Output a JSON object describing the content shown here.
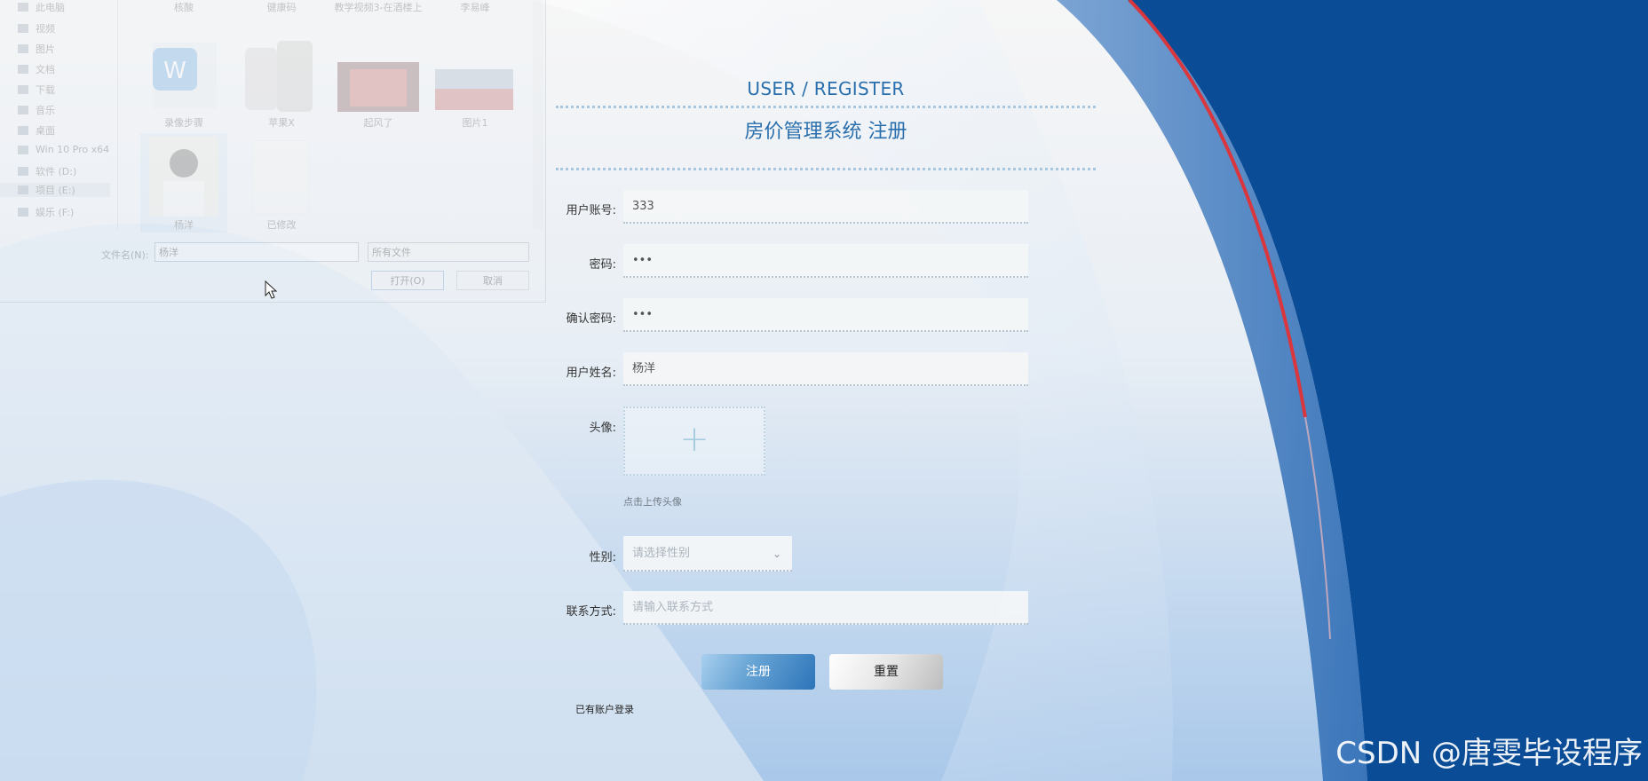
{
  "register": {
    "subtitle": "USER / REGISTER",
    "title": "房价管理系统 注册",
    "fields": [
      {
        "label": "用户账号:",
        "value": "333"
      },
      {
        "label": "密码:",
        "value": "•••"
      },
      {
        "label": "确认密码:",
        "value": "•••"
      },
      {
        "label": "用户姓名:",
        "value": "杨洋"
      }
    ],
    "avatar": {
      "label": "头像:",
      "plus": "+",
      "hint": "点击上传头像"
    },
    "gender": {
      "label": "性别:",
      "placeholder": "请选择性别",
      "chevron": "⌄"
    },
    "contact": {
      "label": "联系方式:",
      "placeholder": "请输入联系方式"
    },
    "buttons": {
      "register": "注册",
      "reset": "重置"
    },
    "login_link": "已有账户登录"
  },
  "watermark": "CSDN @唐雯毕设程序",
  "file_dialog": {
    "nav": [
      "此电脑",
      "视频",
      "图片",
      "文档",
      "下载",
      "音乐",
      "桌面",
      "Win 10 Pro x64",
      "软件 (D:)",
      "项目 (E:)",
      "娱乐 (F:)"
    ],
    "top_items": [
      "核酸",
      "健康码",
      "教学视频3-在酒楼上",
      "李易峰"
    ],
    "files": [
      {
        "name": "录像步骤"
      },
      {
        "name": "苹果X"
      },
      {
        "name": "起风了"
      },
      {
        "name": "图片1"
      },
      {
        "name": "杨洋"
      },
      {
        "name": "已修改"
      }
    ],
    "filename_label": "文件名(N):",
    "filename_value": "杨洋",
    "filetype": "所有文件",
    "open_button": "打开(O)",
    "cancel_button": "取消"
  },
  "colors": {
    "accent": "#2a6fad",
    "deep_blue": "#0b4c97",
    "red_stripe": "#d9363e"
  }
}
